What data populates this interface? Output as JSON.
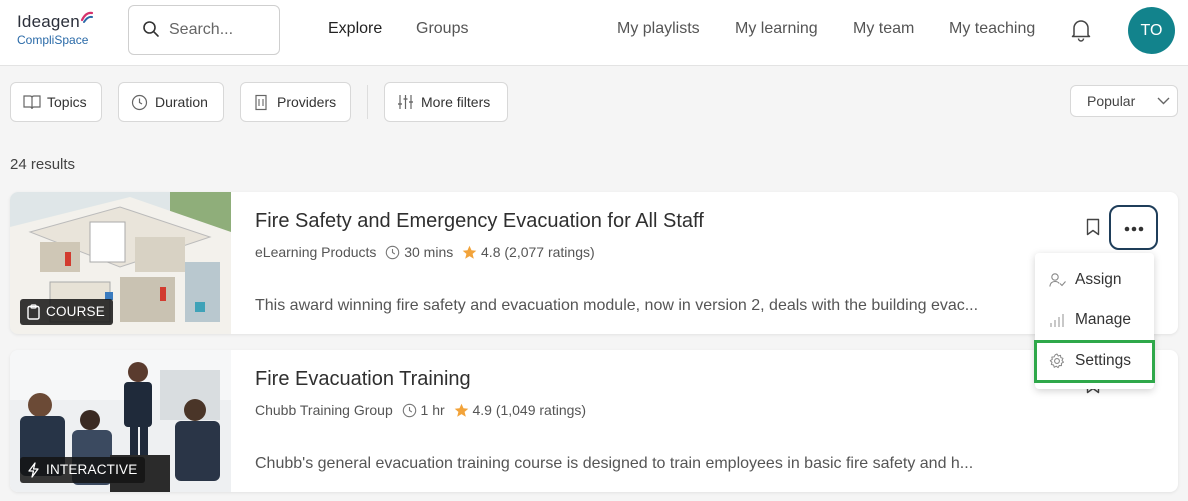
{
  "logo": {
    "line1": "Ideagen",
    "line2": "CompliSpace"
  },
  "search": {
    "placeholder": "Search..."
  },
  "nav": {
    "explore": "Explore",
    "groups": "Groups",
    "my_playlists": "My playlists",
    "my_learning": "My learning",
    "my_team": "My team",
    "my_teaching": "My teaching"
  },
  "user": {
    "initials": "TO"
  },
  "filters": {
    "topics": "Topics",
    "duration": "Duration",
    "providers": "Providers",
    "more": "More filters",
    "sort": "Popular"
  },
  "results_count": "24 results",
  "cards": [
    {
      "title": "Fire Safety and Emergency Evacuation for All Staff",
      "provider": "eLearning Products",
      "duration": "30 mins",
      "rating": "4.8",
      "ratings_count": "(2,077 ratings)",
      "description": "This award winning fire safety and evacuation module, now in version 2, deals with the building evac...",
      "badge": "COURSE"
    },
    {
      "title": "Fire Evacuation Training",
      "provider": "Chubb Training Group",
      "duration": "1 hr",
      "rating": "4.9",
      "ratings_count": "(1,049 ratings)",
      "description": "Chubb's general evacuation training course is designed to train employees in basic fire safety and h...",
      "badge": "INTERACTIVE"
    }
  ],
  "menu": {
    "assign": "Assign",
    "manage": "Manage",
    "settings": "Settings"
  },
  "colors": {
    "accent": "#12838c",
    "highlight": "#2fa84a",
    "star": "#f2a33a",
    "focus_border": "#1f3e5a"
  }
}
